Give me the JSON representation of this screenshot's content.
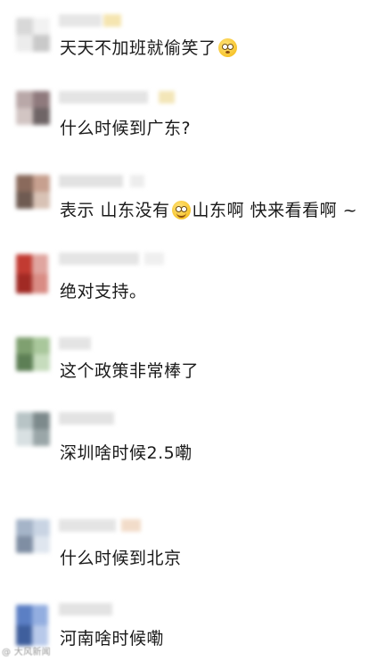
{
  "comments": [
    {
      "text": "天天不加班就偷笑了",
      "emoji": "flushed-face-emoji",
      "avatar_colors": [
        "#d8d8d8",
        "#f2f2f2",
        "#ececec",
        "#c9c9c9"
      ],
      "name_colors": [
        "#e6e6e6",
        "#f5e5b0"
      ]
    },
    {
      "text": "什么时候到广东?",
      "avatar_colors": [
        "#b9a8a8",
        "#8f7a7d",
        "#d2c5c3",
        "#6f6566"
      ],
      "name_colors": [
        "#e4e4e4",
        "#f3e6b8"
      ]
    },
    {
      "text_before": "表示 山东没有",
      "emoji": "smiling-face-emoji",
      "text_after": "山东啊  快来看看啊 ~",
      "avatar_colors": [
        "#8a6a5c",
        "#c7a08f",
        "#6f5b52",
        "#d8c2b5"
      ],
      "name_colors": [
        "#e2e2e2",
        "#ededed"
      ]
    },
    {
      "text": "绝对支持。",
      "avatar_colors": [
        "#c23b32",
        "#e0a59f",
        "#a12a24",
        "#d98c84"
      ],
      "name_colors": [
        "#e5e5e5",
        "#efefef"
      ]
    },
    {
      "text": "这个政策非常棒了",
      "avatar_colors": [
        "#7fa070",
        "#a9c79b",
        "#5d7f55",
        "#c6dcbd"
      ],
      "name_colors": [
        "#e4e4e4",
        "#eeeeee"
      ]
    },
    {
      "text": "深圳啥时候2.5嘞",
      "avatar_colors": [
        "#b8c4c6",
        "#7d8a8c",
        "#d8e0e2",
        "#9aa6a8"
      ],
      "name_colors": [
        "#e3e3e3",
        "#ececec"
      ]
    },
    {
      "text": "什么时候到北京",
      "avatar_colors": [
        "#a5b4c8",
        "#c9d4e3",
        "#7f8ea3",
        "#dfe6ef"
      ],
      "name_colors": [
        "#e4e4e4",
        "#f2dcc9"
      ]
    },
    {
      "text": "河南啥时候嘞",
      "avatar_colors": [
        "#5b7fc4",
        "#93aee0",
        "#3f5f9d",
        "#b8c9ea"
      ],
      "name_colors": [
        "#e3e3e3",
        "#ebebeb"
      ]
    }
  ],
  "watermark": "@ 大风新闻"
}
